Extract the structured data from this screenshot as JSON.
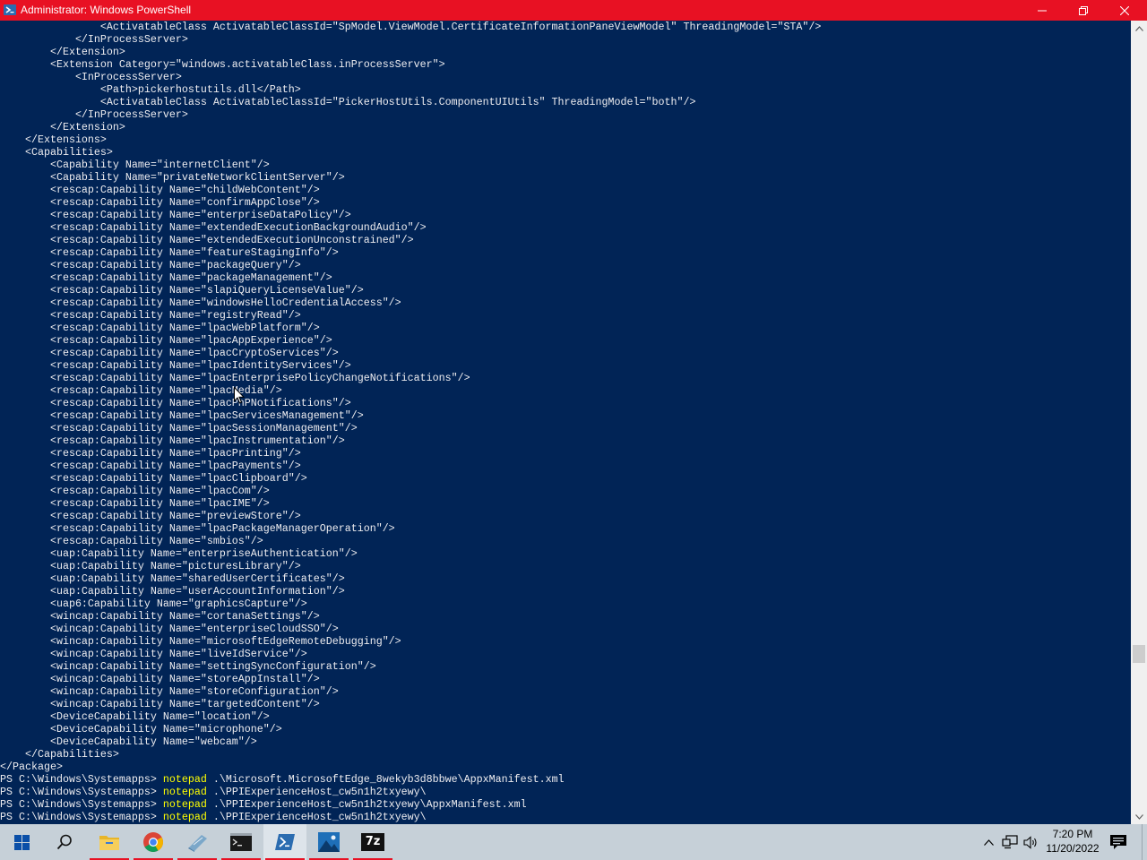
{
  "window": {
    "title": "Administrator: Windows PowerShell",
    "titlebar_color": "#e81123",
    "background_color": "#012456"
  },
  "console": {
    "text_color": "#eeedf0",
    "command_color": "#ffff00",
    "lines": [
      {
        "text": "                <ActivatableClass ActivatableClassId=\"SpModel.ViewModel.CertificateInformationPaneViewModel\" ThreadingModel=\"STA\"/>"
      },
      {
        "text": "            </InProcessServer>"
      },
      {
        "text": "        </Extension>"
      },
      {
        "text": "        <Extension Category=\"windows.activatableClass.inProcessServer\">"
      },
      {
        "text": "            <InProcessServer>"
      },
      {
        "text": "                <Path>pickerhostutils.dll</Path>"
      },
      {
        "text": "                <ActivatableClass ActivatableClassId=\"PickerHostUtils.ComponentUIUtils\" ThreadingModel=\"both\"/>"
      },
      {
        "text": "            </InProcessServer>"
      },
      {
        "text": "        </Extension>"
      },
      {
        "text": "    </Extensions>"
      },
      {
        "text": "    <Capabilities>"
      },
      {
        "text": "        <Capability Name=\"internetClient\"/>"
      },
      {
        "text": "        <Capability Name=\"privateNetworkClientServer\"/>"
      },
      {
        "text": "        <rescap:Capability Name=\"childWebContent\"/>"
      },
      {
        "text": "        <rescap:Capability Name=\"confirmAppClose\"/>"
      },
      {
        "text": "        <rescap:Capability Name=\"enterpriseDataPolicy\"/>"
      },
      {
        "text": "        <rescap:Capability Name=\"extendedExecutionBackgroundAudio\"/>"
      },
      {
        "text": "        <rescap:Capability Name=\"extendedExecutionUnconstrained\"/>"
      },
      {
        "text": "        <rescap:Capability Name=\"featureStagingInfo\"/>"
      },
      {
        "text": "        <rescap:Capability Name=\"packageQuery\"/>"
      },
      {
        "text": "        <rescap:Capability Name=\"packageManagement\"/>"
      },
      {
        "text": "        <rescap:Capability Name=\"slapiQueryLicenseValue\"/>"
      },
      {
        "text": "        <rescap:Capability Name=\"windowsHelloCredentialAccess\"/>"
      },
      {
        "text": "        <rescap:Capability Name=\"registryRead\"/>"
      },
      {
        "text": "        <rescap:Capability Name=\"lpacWebPlatform\"/>"
      },
      {
        "text": "        <rescap:Capability Name=\"lpacAppExperience\"/>"
      },
      {
        "text": "        <rescap:Capability Name=\"lpacCryptoServices\"/>"
      },
      {
        "text": "        <rescap:Capability Name=\"lpacIdentityServices\"/>"
      },
      {
        "text": "        <rescap:Capability Name=\"lpacEnterprisePolicyChangeNotifications\"/>"
      },
      {
        "text": "        <rescap:Capability Name=\"lpacMedia\"/>"
      },
      {
        "text": "        <rescap:Capability Name=\"lpacPnPNotifications\"/>"
      },
      {
        "text": "        <rescap:Capability Name=\"lpacServicesManagement\"/>"
      },
      {
        "text": "        <rescap:Capability Name=\"lpacSessionManagement\"/>"
      },
      {
        "text": "        <rescap:Capability Name=\"lpacInstrumentation\"/>"
      },
      {
        "text": "        <rescap:Capability Name=\"lpacPrinting\"/>"
      },
      {
        "text": "        <rescap:Capability Name=\"lpacPayments\"/>"
      },
      {
        "text": "        <rescap:Capability Name=\"lpacClipboard\"/>"
      },
      {
        "text": "        <rescap:Capability Name=\"lpacCom\"/>"
      },
      {
        "text": "        <rescap:Capability Name=\"lpacIME\"/>"
      },
      {
        "text": "        <rescap:Capability Name=\"previewStore\"/>"
      },
      {
        "text": "        <rescap:Capability Name=\"lpacPackageManagerOperation\"/>"
      },
      {
        "text": "        <rescap:Capability Name=\"smbios\"/>"
      },
      {
        "text": "        <uap:Capability Name=\"enterpriseAuthentication\"/>"
      },
      {
        "text": "        <uap:Capability Name=\"picturesLibrary\"/>"
      },
      {
        "text": "        <uap:Capability Name=\"sharedUserCertificates\"/>"
      },
      {
        "text": "        <uap:Capability Name=\"userAccountInformation\"/>"
      },
      {
        "text": "        <uap6:Capability Name=\"graphicsCapture\"/>"
      },
      {
        "text": "        <wincap:Capability Name=\"cortanaSettings\"/>"
      },
      {
        "text": "        <wincap:Capability Name=\"enterpriseCloudSSO\"/>"
      },
      {
        "text": "        <wincap:Capability Name=\"microsoftEdgeRemoteDebugging\"/>"
      },
      {
        "text": "        <wincap:Capability Name=\"liveIdService\"/>"
      },
      {
        "text": "        <wincap:Capability Name=\"settingSyncConfiguration\"/>"
      },
      {
        "text": "        <wincap:Capability Name=\"storeAppInstall\"/>"
      },
      {
        "text": "        <wincap:Capability Name=\"storeConfiguration\"/>"
      },
      {
        "text": "        <wincap:Capability Name=\"targetedContent\"/>"
      },
      {
        "text": "        <DeviceCapability Name=\"location\"/>"
      },
      {
        "text": "        <DeviceCapability Name=\"microphone\"/>"
      },
      {
        "text": "        <DeviceCapability Name=\"webcam\"/>"
      },
      {
        "text": "    </Capabilities>"
      },
      {
        "text": "</Package>"
      },
      {
        "prompt": "PS C:\\Windows\\Systemapps> ",
        "command": "notepad",
        "args": " .\\Microsoft.MicrosoftEdge_8wekyb3d8bbwe\\AppxManifest.xml"
      },
      {
        "prompt": "PS C:\\Windows\\Systemapps> ",
        "command": "notepad",
        "args": " .\\PPIExperienceHost_cw5n1h2txyewy\\"
      },
      {
        "prompt": "PS C:\\Windows\\Systemapps> ",
        "command": "notepad",
        "args": " .\\PPIExperienceHost_cw5n1h2txyewy\\AppxManifest.xml"
      },
      {
        "prompt": "PS C:\\Windows\\Systemapps> ",
        "command": "notepad",
        "args": " .\\PPIExperienceHost_cw5n1h2txyewy\\"
      }
    ]
  },
  "taskbar": {
    "background_color": "#c6d0d8",
    "apps": [
      {
        "name": "start-button",
        "icon": "windows-logo-icon"
      },
      {
        "name": "search-button",
        "icon": "search-icon"
      },
      {
        "name": "file-explorer",
        "icon": "folder-icon",
        "running": true
      },
      {
        "name": "chrome",
        "icon": "chrome-icon",
        "running": true
      },
      {
        "name": "notepad",
        "icon": "notepad-icon",
        "running": true
      },
      {
        "name": "command-prompt",
        "icon": "cmd-icon",
        "running": true
      },
      {
        "name": "powershell",
        "icon": "powershell-icon",
        "running": true,
        "active": true
      },
      {
        "name": "photos",
        "icon": "photos-icon",
        "running": true
      },
      {
        "name": "7zip",
        "icon": "7zip-icon",
        "label": "7z",
        "running": true
      }
    ],
    "tray": {
      "time": "7:20 PM",
      "date": "11/20/2022"
    }
  }
}
